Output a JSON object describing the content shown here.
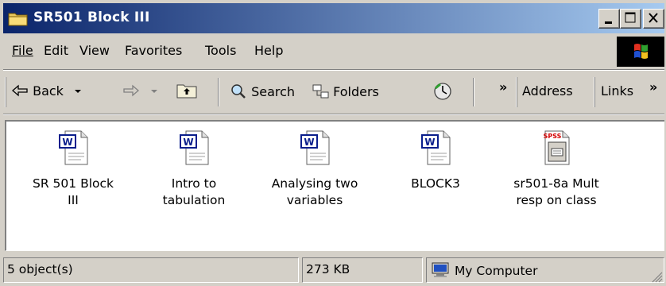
{
  "window": {
    "title": "SR501 Block III",
    "minimize_glyph": "_",
    "maximize_glyph": "□",
    "close_glyph": "×"
  },
  "menubar": {
    "items": [
      {
        "label": "File",
        "accesskey": "F"
      },
      {
        "label": "Edit",
        "accesskey": "E"
      },
      {
        "label": "View",
        "accesskey": "V"
      },
      {
        "label": "Favorites",
        "accesskey": "a"
      },
      {
        "label": "Tools",
        "accesskey": "T"
      },
      {
        "label": "Help",
        "accesskey": "H"
      }
    ]
  },
  "toolbar": {
    "back_label": "Back",
    "search_label": "Search",
    "folders_label": "Folders",
    "chevron": "»",
    "address_label": "Address",
    "links_label": "Links",
    "links_chevron": "»"
  },
  "files": [
    {
      "name": "SR 501 Block III",
      "line1": "SR 501 Block",
      "line2": "III",
      "icon": "word-doc-icon"
    },
    {
      "name": "Intro to tabulation",
      "line1": "Intro to",
      "line2": "tabulation",
      "icon": "word-doc-icon"
    },
    {
      "name": "Analysing two variables",
      "line1": "Analysing two",
      "line2": "variables",
      "icon": "word-doc-icon"
    },
    {
      "name": "BLOCK3",
      "line1": "BLOCK3",
      "line2": "",
      "icon": "word-doc-icon"
    },
    {
      "name": "sr501-8a Mult resp on class",
      "line1": "sr501-8a Mult",
      "line2": "resp on class",
      "icon": "spss-file-icon"
    }
  ],
  "statusbar": {
    "object_count": "5 object(s)",
    "size": "273 KB",
    "zone": "My Computer"
  },
  "colors": {
    "title_gradient_start": "#0a246a",
    "title_gradient_end": "#a6caf0",
    "face": "#d4d0c8",
    "word_blue": "#0a1e8c",
    "spss_red": "#d40000"
  }
}
